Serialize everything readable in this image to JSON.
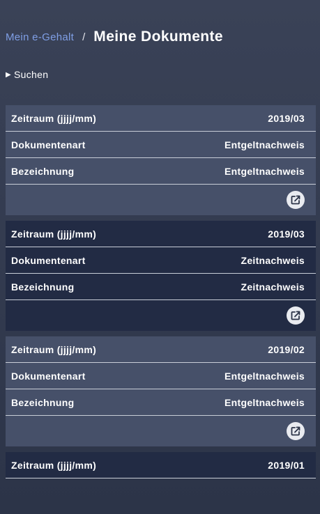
{
  "header": {
    "breadcrumb_link": "Mein e-Gehalt",
    "breadcrumb_separator": "/",
    "title": "Meine Dokumente"
  },
  "search": {
    "toggle_icon": "triangle-right-icon",
    "label": "Suchen"
  },
  "colors": {
    "accent_link": "#7f9fe6",
    "card_light": "#465069",
    "card_dark": "#222b44",
    "background": "#2f374c"
  },
  "documents": [
    {
      "zeitraum_label": "Zeitraum (jjjj/mm)",
      "zeitraum_value": "2019/03",
      "art_label": "Dokumentenart",
      "art_value": "Entgeltnachweis",
      "bezeichnung_label": "Bezeichnung",
      "bezeichnung_value": "Entgeltnachweis",
      "action_icon": "open-external-icon"
    },
    {
      "zeitraum_label": "Zeitraum (jjjj/mm)",
      "zeitraum_value": "2019/03",
      "art_label": "Dokumentenart",
      "art_value": "Zeitnachweis",
      "bezeichnung_label": "Bezeichnung",
      "bezeichnung_value": "Zeitnachweis",
      "action_icon": "open-external-icon"
    },
    {
      "zeitraum_label": "Zeitraum (jjjj/mm)",
      "zeitraum_value": "2019/02",
      "art_label": "Dokumentenart",
      "art_value": "Entgeltnachweis",
      "bezeichnung_label": "Bezeichnung",
      "bezeichnung_value": "Entgeltnachweis",
      "action_icon": "open-external-icon"
    },
    {
      "zeitraum_label": "Zeitraum (jjjj/mm)",
      "zeitraum_value": "2019/01"
    }
  ]
}
